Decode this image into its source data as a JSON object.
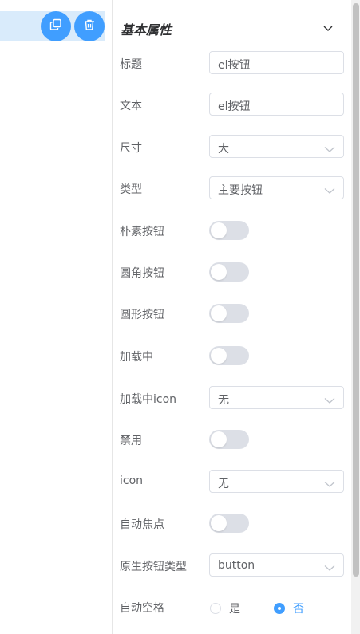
{
  "toolbar": {
    "copy_icon": "copy-icon",
    "delete_icon": "trash-icon",
    "accent": "#409eff"
  },
  "panel": {
    "section_title": "基本属性",
    "collapse_icon": "chevron-down-icon"
  },
  "fields": {
    "title": {
      "label": "标题",
      "value": "el按钮"
    },
    "text": {
      "label": "文本",
      "value": "el按钮"
    },
    "size": {
      "label": "尺寸",
      "value": "大"
    },
    "type": {
      "label": "类型",
      "value": "主要按钮"
    },
    "plain": {
      "label": "朴素按钮",
      "on": false
    },
    "round": {
      "label": "圆角按钮",
      "on": false
    },
    "circle": {
      "label": "圆形按钮",
      "on": false
    },
    "loading": {
      "label": "加载中",
      "on": false
    },
    "loading_icon": {
      "label": "加载中icon",
      "value": "无"
    },
    "disabled": {
      "label": "禁用",
      "on": false
    },
    "icon": {
      "label": "icon",
      "value": "无"
    },
    "autofocus": {
      "label": "自动焦点",
      "on": false
    },
    "native_type": {
      "label": "原生按钮类型",
      "value": "button"
    },
    "auto_space": {
      "label": "自动空格",
      "options": [
        "是",
        "否"
      ],
      "selected": "否"
    }
  }
}
